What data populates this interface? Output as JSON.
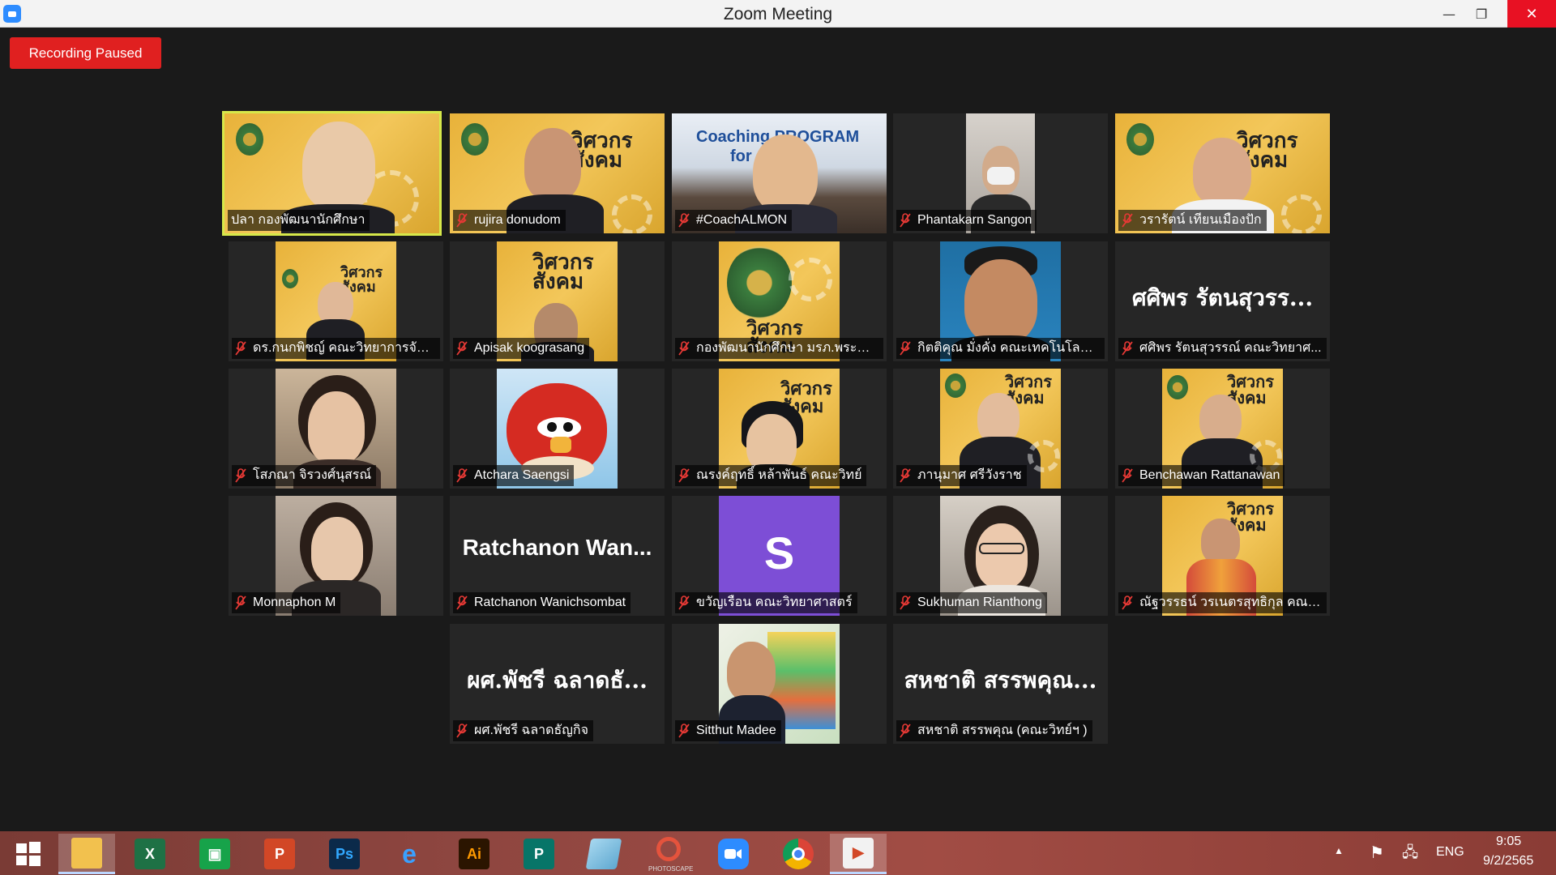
{
  "window": {
    "title": "Zoom Meeting",
    "minimize": "—",
    "maximize": "❐",
    "close": "✕"
  },
  "recording": {
    "label": "Recording Paused"
  },
  "participants": [
    {
      "name": "ปลา กองพัฒนานักศึกษา",
      "muted": false,
      "active": true
    },
    {
      "name": "rujira donudom",
      "muted": true
    },
    {
      "name": "#CoachALMON",
      "muted": true
    },
    {
      "name": "Phantakarn Sangon",
      "muted": true
    },
    {
      "name": "วรารัตน์ เทียนเมืองปัก",
      "muted": true
    },
    {
      "name": "ดร.กนกพิชญ์ คณะวิทยาการจัด...",
      "muted": true
    },
    {
      "name": "Apisak koograsang",
      "muted": true
    },
    {
      "name": "กองพัฒนานักศึกษา มรภ.พระนคร",
      "muted": true
    },
    {
      "name": "กิตติคุณ มั่งคั่ง คณะเทคโนโลยีอุ...",
      "muted": true
    },
    {
      "name": "ศศิพร รัตนสุวรรณ์ คณะวิทยาศ...",
      "muted": true,
      "display_name": "ศศิพร รัตนสุวรร..."
    },
    {
      "name": "โสภณา จิรวงศ์นุสรณ์",
      "muted": true
    },
    {
      "name": "Atchara Saengsi",
      "muted": true
    },
    {
      "name": "ณรงค์ฤทธิ์ หล้าพันธ์ คณะวิทย์",
      "muted": true
    },
    {
      "name": "ภานุมาศ ศรีวังราช",
      "muted": true
    },
    {
      "name": "Benchawan Rattanawan",
      "muted": true
    },
    {
      "name": "Monnaphon M",
      "muted": true
    },
    {
      "name": "Ratchanon Wanichsombat",
      "muted": true,
      "display_name": "Ratchanon  Wan..."
    },
    {
      "name": "ขวัญเรือน คณะวิทยาศาสตร์",
      "muted": true,
      "avatar_letter": "S"
    },
    {
      "name": "Sukhuman Rianthong",
      "muted": true
    },
    {
      "name": "ณัฐวรรธน์ วรเนตรสุทธิกุล คณะเ...",
      "muted": true
    },
    {
      "name": "ผศ.พัชรี ฉลาดธัญกิจ",
      "muted": true,
      "display_name": "ผศ.พัชรี  ฉลาดธั..."
    },
    {
      "name": "Sitthut Madee",
      "muted": true
    },
    {
      "name": "สหชาติ สรรพคุณ (คณะวิทย์ฯ )",
      "muted": true,
      "display_name": "สหชาติ สรรพคุณ..."
    }
  ],
  "video_text": {
    "banner": "วิศวกรสังคม",
    "coaching_line1": "Coaching PROGRAM",
    "coaching_line2": "for"
  },
  "taskbar": {
    "apps": [
      "start",
      "file-explorer",
      "excel",
      "store",
      "powerpoint",
      "photoshop",
      "internet-explorer",
      "illustrator",
      "publisher",
      "notepad",
      "photoscape",
      "zoom",
      "chrome",
      "ppt-viewer"
    ],
    "photoscape_label": "PHOTOSCAPE",
    "lang": "ENG",
    "time": "9:05",
    "date": "9/2/2565"
  },
  "colors": {
    "accent": "#d6e84a",
    "recording": "#e02020",
    "zoom": "#2d8cff",
    "mic_muted": "#e53935"
  }
}
